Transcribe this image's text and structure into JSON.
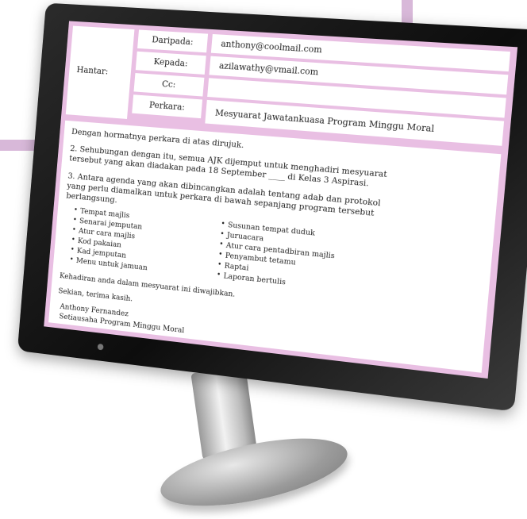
{
  "email": {
    "hantar_label": "Hantar:",
    "daripada_label": "Daripada:",
    "daripada_value": "anthony@coolmail.com",
    "kepada_label": "Kepada:",
    "kepada_value": "azilawathy@vmail.com",
    "cc_label": "Cc:",
    "cc_value": "",
    "perkara_label": "Perkara:",
    "perkara_value": "Mesyuarat Jawatankuasa Program Minggu Moral"
  },
  "body": {
    "greeting": "Dengan hormatnya perkara di atas dirujuk.",
    "para2_line1": "2.  Sehubungan dengan itu, semua AJK dijemput untuk menghadiri mesyuarat",
    "para2_line2": "tersebut yang akan diadakan pada 18 September ____ di Kelas 3 Aspirasi.",
    "para3_line1": "3.  Antara agenda yang akan dibincangkan adalah tentang adab dan protokol",
    "para3_line2": "yang perlu diamalkan untuk perkara di bawah sepanjang program tersebut",
    "para3_line3": "berlangsung.",
    "list_left": [
      "Tempat majlis",
      "Senarai jemputan",
      "Atur cara majlis",
      "Kod pakaian",
      "Kad jemputan",
      "Menu untuk jamuan"
    ],
    "list_right": [
      "Susunan tempat duduk",
      "Juruacara",
      "Atur cara pentadbiran majlis",
      "Penyambut tetamu",
      "Raptai",
      "Laporan bertulis"
    ],
    "attendance": "Kehadiran anda dalam mesyuarat ini diwajibkan.",
    "closing": "Sekian, terima kasih.",
    "sender_name": "Anthony Fernandez",
    "sender_title": "Setiausaha Program Minggu Moral"
  },
  "background": {
    "letter": "m"
  },
  "colors": {
    "screen_pink": "#e9bfe3",
    "bg_panel": "#d8b8d9"
  }
}
